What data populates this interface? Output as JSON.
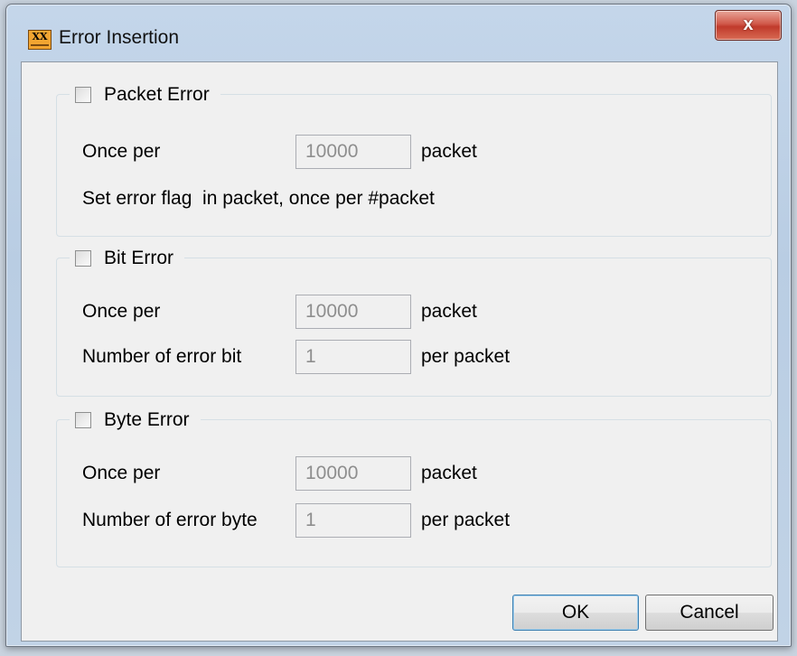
{
  "window": {
    "title": "Error Insertion",
    "icon": "xx-app-icon",
    "icon_text": "XX",
    "close_label": "x"
  },
  "packet_error": {
    "label": "Packet Error",
    "checked": false,
    "once_per_label": "Once per",
    "once_per_value": "10000",
    "once_per_unit": "packet",
    "description": "Set error flag  in packet, once per #packet"
  },
  "bit_error": {
    "label": "Bit Error",
    "checked": false,
    "once_per_label": "Once per",
    "once_per_value": "10000",
    "once_per_unit": "packet",
    "count_label": "Number of error bit",
    "count_value": "1",
    "count_unit": "per packet"
  },
  "byte_error": {
    "label": "Byte Error",
    "checked": false,
    "once_per_label": "Once per",
    "once_per_value": "10000",
    "once_per_unit": "packet",
    "count_label": "Number of error byte",
    "count_value": "1",
    "count_unit": "per packet"
  },
  "buttons": {
    "ok": "OK",
    "cancel": "Cancel"
  }
}
